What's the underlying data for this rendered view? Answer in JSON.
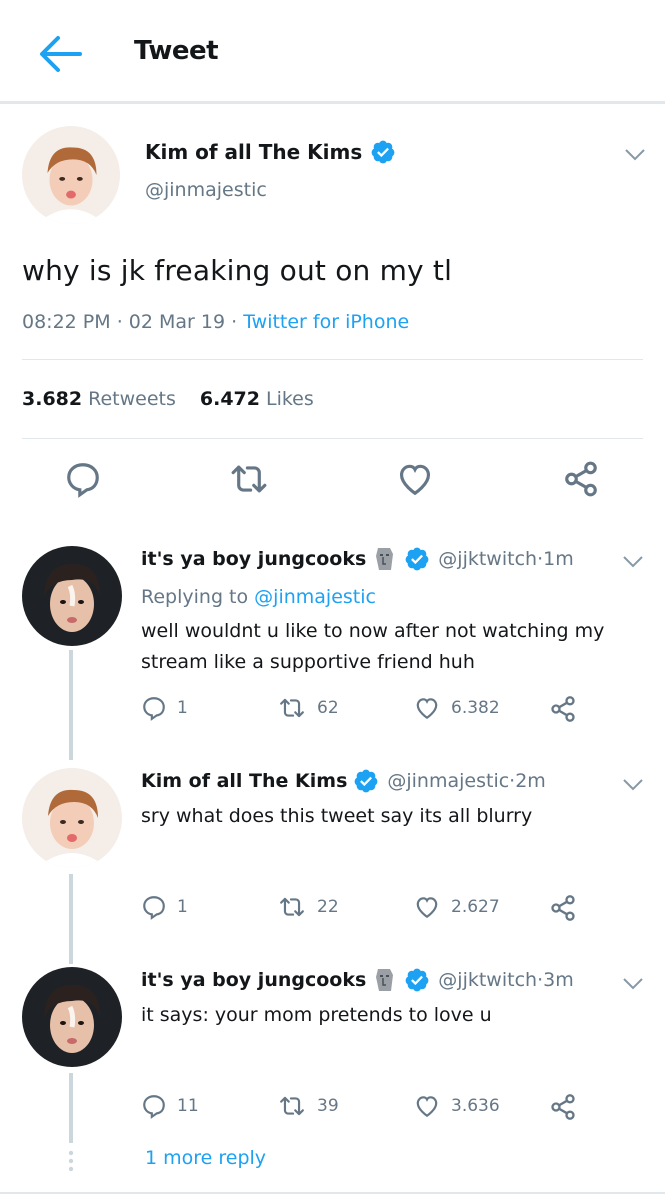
{
  "header": {
    "title": "Tweet",
    "back_icon": "arrow-left-icon"
  },
  "colors": {
    "accent": "#1da1f2",
    "text": "#14171a",
    "muted": "#657786",
    "divider": "#e1e8ed"
  },
  "main_tweet": {
    "name": "Kim of all The Kims",
    "handle": "@jinmajestic",
    "text": "why is jk freaking out on my tl",
    "time": "08:22 PM",
    "date": "02 Mar 19",
    "source": "Twitter for iPhone",
    "retweets_count": "3.682",
    "retweets_label": "Retweets",
    "likes_count": "6.472",
    "likes_label": "Likes"
  },
  "replies": [
    {
      "name": "it's ya boy jungcooks",
      "handle": "@jjktwitch",
      "time": "1m",
      "replying_label": "Replying to",
      "replying_to": "@jinmajestic",
      "text": "well wouldnt u like to now after not watching my stream like a supportive friend huh",
      "reply_count": "1",
      "retweet_count": "62",
      "like_count": "6.382"
    },
    {
      "name": "Kim of all The Kims",
      "handle": "@jinmajestic",
      "time": "2m",
      "text": "sry what does this tweet say its all blurry",
      "reply_count": "1",
      "retweet_count": "22",
      "like_count": "2.627"
    },
    {
      "name": "it's ya boy jungcooks",
      "handle": "@jjktwitch",
      "time": "3m",
      "text": "it says: your mom pretends to love u",
      "reply_count": "11",
      "retweet_count": "39",
      "like_count": "3.636"
    }
  ],
  "more_reply_label": "1 more reply",
  "separator": " · "
}
